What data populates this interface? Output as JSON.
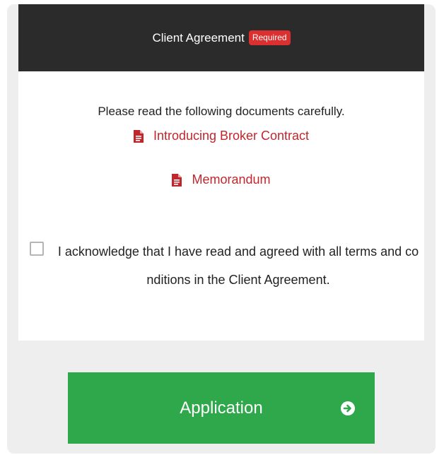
{
  "header": {
    "title": "Client Agreement",
    "badge": "Required"
  },
  "body": {
    "instructions": "Please read the following documents carefully.",
    "documents": [
      {
        "label": "Introducing Broker Contract",
        "icon": "document-icon"
      },
      {
        "label": "Memorandum",
        "icon": "document-icon"
      }
    ]
  },
  "acknowledgement": {
    "checked": false,
    "text": "I acknowledge that I have read and agreed with all terms and conditions in the Client Agreement."
  },
  "submit": {
    "label": "Application",
    "icon": "arrow-circle-right-icon"
  },
  "colors": {
    "header_bg": "#2b2b2b",
    "badge_bg": "#dc2f2f",
    "link": "#c0272d",
    "button_bg": "#2ea84a"
  }
}
